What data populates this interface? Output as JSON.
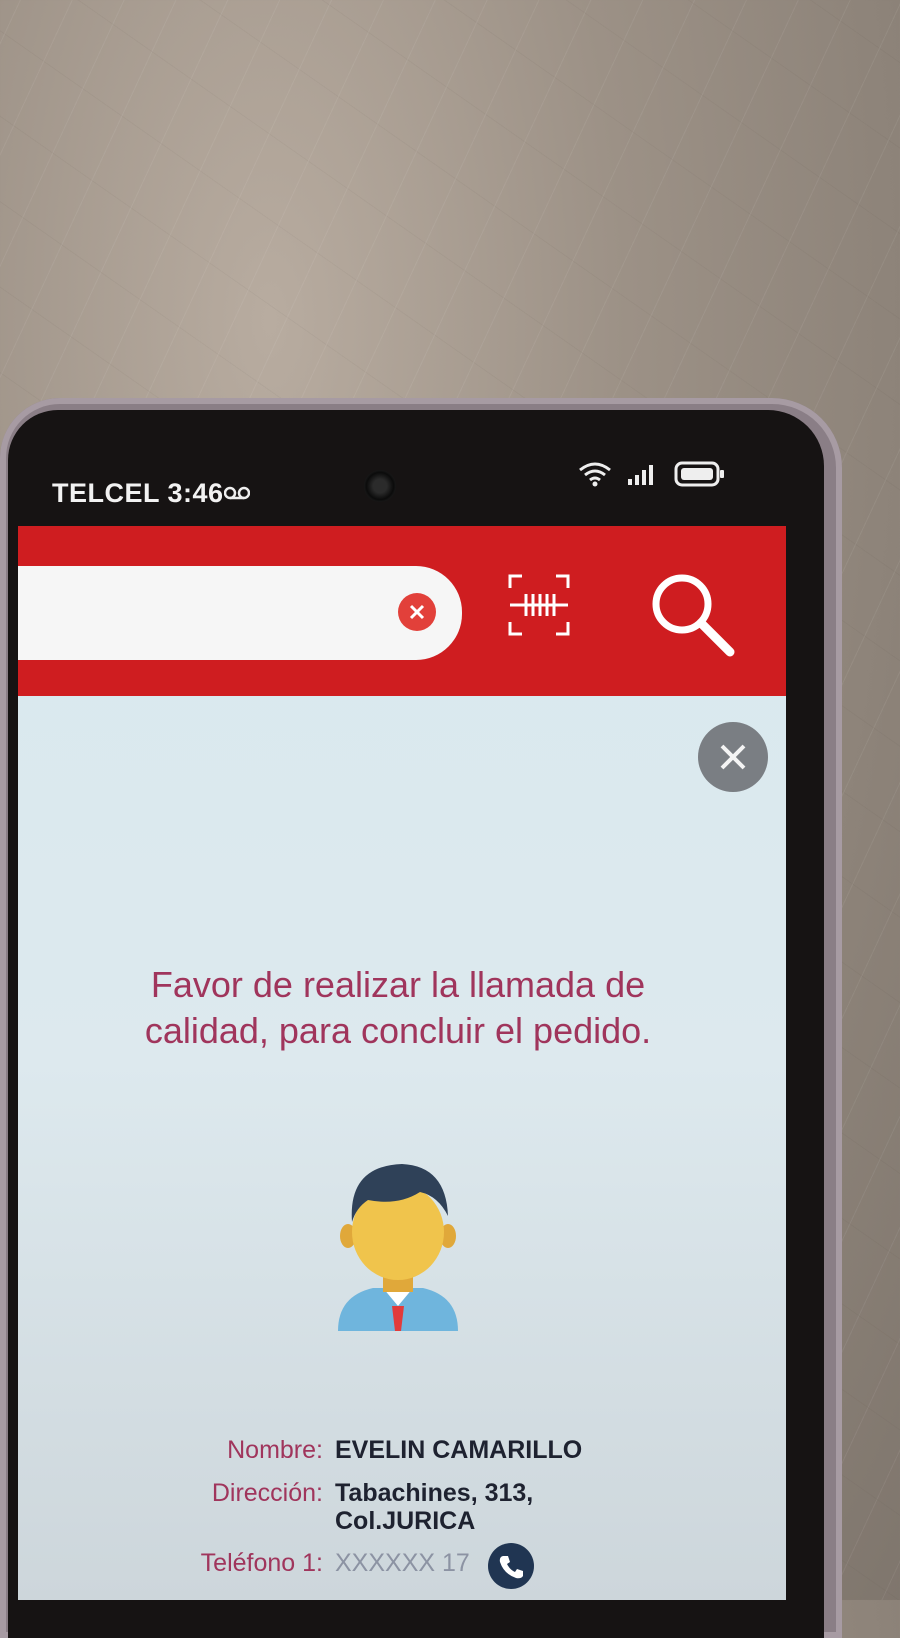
{
  "status_bar": {
    "carrier": "TELCEL",
    "time": "3:46"
  },
  "toolbar": {
    "search_placeholder": "",
    "clear_icon": "close-icon",
    "barcode_icon": "barcode-scan-icon",
    "search_icon": "search-icon",
    "brand_color": "#cf1d20"
  },
  "modal": {
    "message": "Favor de realizar la llamada de calidad, para concluir el pedido.",
    "avatar_icon": "person-avatar-icon",
    "fields": [
      {
        "label": "Nombre:",
        "value": "EVELIN CAMARILLO"
      },
      {
        "label": "Dirección:",
        "value": "Tabachines, 313, Col.JURICA"
      },
      {
        "label": "Teléfono 1:",
        "value": "XXXXXX 17"
      }
    ]
  }
}
